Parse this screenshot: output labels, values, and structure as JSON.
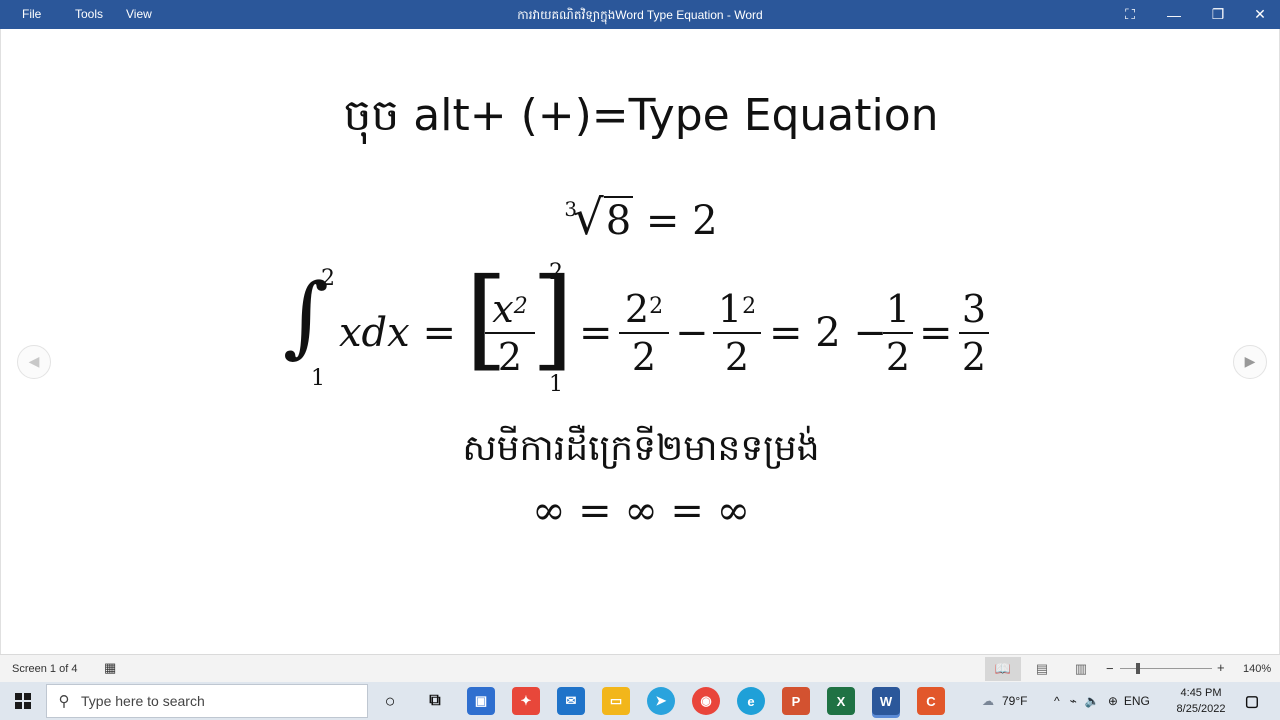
{
  "titlebar": {
    "menu": [
      "File",
      "Tools",
      "View"
    ],
    "title": "ការវាយគណិតវិទ្យាក្នុងWord  Type Equation  -  Word",
    "controls": {
      "focus": "⛶",
      "minimize": "—",
      "restore": "❐",
      "close": "✕"
    }
  },
  "document": {
    "heading": "ចុច alt+ (+)=Type Equation",
    "eq1": {
      "index": "3",
      "radicand": "8",
      "rhs": "= 2"
    },
    "eq2": {
      "integral_upper": "2",
      "integral_lower": "1",
      "integrand": "xdx =",
      "bracket_frac_num": "x",
      "bracket_frac_num_sup": "2",
      "bracket_frac_den": "2",
      "bracket_upper": "2",
      "bracket_lower": "1",
      "frac1_num": "2",
      "frac1_num_sup": "2",
      "frac1_den": "2",
      "frac2_num": "1",
      "frac2_num_sup": "2",
      "frac2_den": "2",
      "mid": "= 2 −",
      "frac3_num": "1",
      "frac3_den": "2",
      "frac4_num": "3",
      "frac4_den": "2"
    },
    "khmer_line": "សមីការដឺក្រេទី២មានទម្រង់",
    "eq3": "∞ = ∞ = ∞"
  },
  "statusbar": {
    "screen": "Screen 1 of 4",
    "zoom_minus": "−",
    "zoom_plus": "+",
    "zoom_level": "140%"
  },
  "taskbar": {
    "search_placeholder": "Type here to search",
    "weather": "79°F",
    "language": "ENG",
    "time": "4:45 PM",
    "date": "8/25/2022"
  },
  "icons": {
    "brand_title": "#2b579a",
    "taskbar_bg": "#dfe6ee"
  }
}
